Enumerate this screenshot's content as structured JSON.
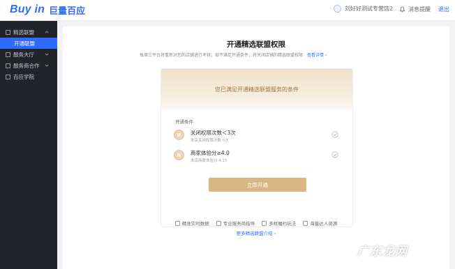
{
  "header": {
    "logo_text": "Buy in",
    "logo_brand": "巨量百应",
    "account_name": "刘好好测试专营店2",
    "messages_label": "消息提醒",
    "logout_label": "退出"
  },
  "sidebar": {
    "items": [
      {
        "label": "精选联盟",
        "expanded": true
      },
      {
        "label": "开通联盟",
        "active": true
      },
      {
        "label": "服务大厅"
      },
      {
        "label": "服务商合作"
      },
      {
        "label": "百应学院"
      }
    ]
  },
  "main": {
    "title": "开通精选联盟权限",
    "description": "每周三平台将重新对您的店铺进行考核，如不满足开通条件，将关闭店铺的精选联盟权限",
    "description_link": "查看详情 ›",
    "card_header": "您已满足开通精选联盟服务的条件",
    "conditions_label": "开通条件",
    "conditions": [
      {
        "name": "关闭权限次数＜3次",
        "detail": "本店关闭权限次数 0次",
        "met": true
      },
      {
        "name": "商家体验分≥4.0",
        "detail": "本店商家体验分 4.15",
        "met": true
      }
    ],
    "open_button": "立即开通",
    "features": [
      "精准实时数据",
      "专业服务商指导",
      "多样履约玩法",
      "海量达人资源"
    ],
    "more_link": "更多精选联盟介绍 ›"
  },
  "watermark": "广东龙网",
  "colors": {
    "accent": "#2f6bff",
    "sidebar_bg": "#22232b",
    "gold": "#d8b784"
  }
}
